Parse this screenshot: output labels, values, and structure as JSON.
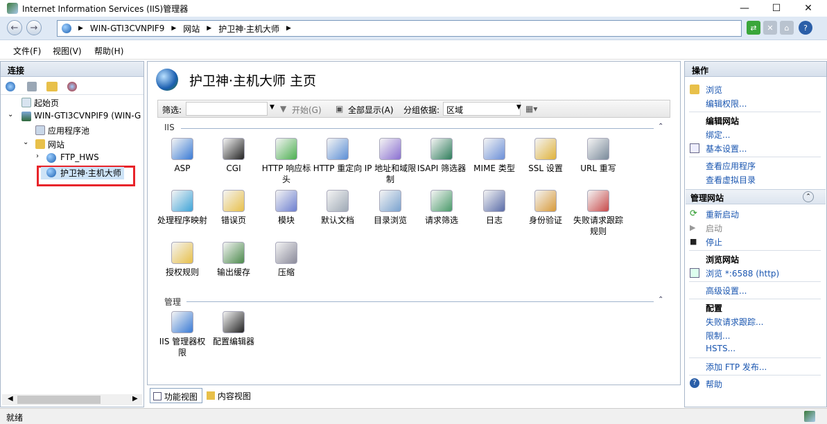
{
  "window": {
    "title": "Internet Information Services (IIS)管理器",
    "min": "—",
    "max": "☐",
    "close": "✕"
  },
  "address": {
    "segments": [
      "WIN-GTI3CVNPIF9",
      "网站",
      "护卫神·主机大师"
    ]
  },
  "menu": [
    "文件(F)",
    "视图(V)",
    "帮助(H)"
  ],
  "connections": {
    "header": "连接",
    "tree": [
      "起始页",
      "WIN-GTI3CVNPIF9 (WIN-G",
      "应用程序池",
      "网站",
      "FTP_HWS",
      "护卫神·主机大师"
    ]
  },
  "main": {
    "title": "护卫神·主机大师 主页",
    "filter": {
      "label": "筛选:",
      "start": "开始(G)",
      "showall": "全部显示(A)",
      "groupby": "分组依据:",
      "groupval": "区域"
    },
    "groups": [
      {
        "name": "IIS",
        "features": [
          [
            "ASP",
            "CGI",
            "HTTP 响应标头",
            "HTTP 重定向",
            "IP 地址和域限制",
            "ISAPI 筛选器",
            "MIME 类型",
            "SSL 设置",
            "URL 重写"
          ],
          [
            "处理程序映射",
            "错误页",
            "模块",
            "默认文档",
            "目录浏览",
            "请求筛选",
            "日志",
            "身份验证",
            "失败请求跟踪规则"
          ],
          [
            "授权规则",
            "输出缓存",
            "压缩"
          ]
        ]
      },
      {
        "name": "管理",
        "features": [
          [
            "IIS 管理器权限",
            "配置编辑器"
          ]
        ]
      }
    ]
  },
  "actions": {
    "header": "操作",
    "items": {
      "browse": "浏览",
      "editperm": "编辑权限...",
      "editsite": "编辑网站",
      "bind": "绑定...",
      "basic": "基本设置...",
      "viewapps": "查看应用程序",
      "viewvdirs": "查看虚拟目录",
      "manage": "管理网站",
      "restart": "重新启动",
      "start": "启动",
      "stop": "停止",
      "browsesite": "浏览网站",
      "browse6588": "浏览 *:6588 (http)",
      "adv": "高级设置...",
      "config": "配置",
      "failreq": "失败请求跟踪...",
      "limits": "限制...",
      "hsts": "HSTS...",
      "ftp": "添加 FTP 发布...",
      "help": "帮助"
    }
  },
  "viewtabs": {
    "features": "功能视图",
    "content": "内容视图"
  },
  "status": {
    "text": "就绪"
  }
}
